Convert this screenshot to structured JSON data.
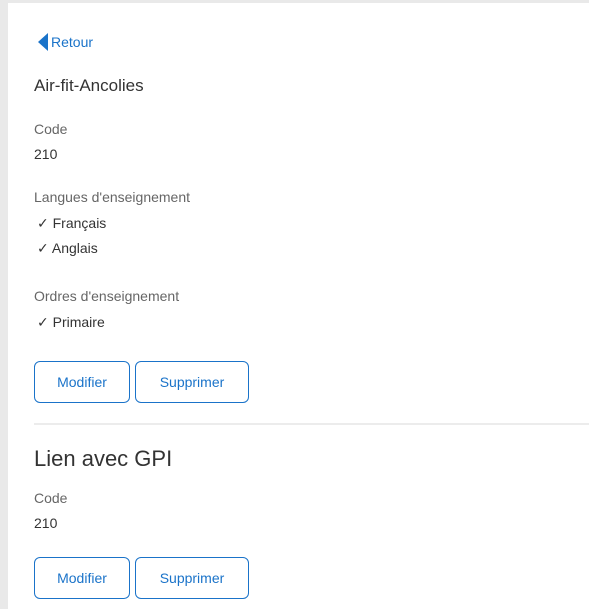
{
  "nav": {
    "back_label": "Retour"
  },
  "section1": {
    "title": "Air-fit-Ancolies",
    "code_label": "Code",
    "code_value": "210",
    "languages_label": "Langues d'enseignement",
    "languages": [
      "Français",
      "Anglais"
    ],
    "orders_label": "Ordres d'enseignement",
    "orders": [
      "Primaire"
    ],
    "edit_label": "Modifier",
    "delete_label": "Supprimer"
  },
  "section2": {
    "title": "Lien avec GPI",
    "code_label": "Code",
    "code_value": "210",
    "edit_label": "Modifier",
    "delete_label": "Supprimer"
  },
  "check_glyph": "✓",
  "colors": {
    "accent": "#1a73c9",
    "text": "#333333",
    "muted": "#666666",
    "border": "#e9e9e9"
  }
}
